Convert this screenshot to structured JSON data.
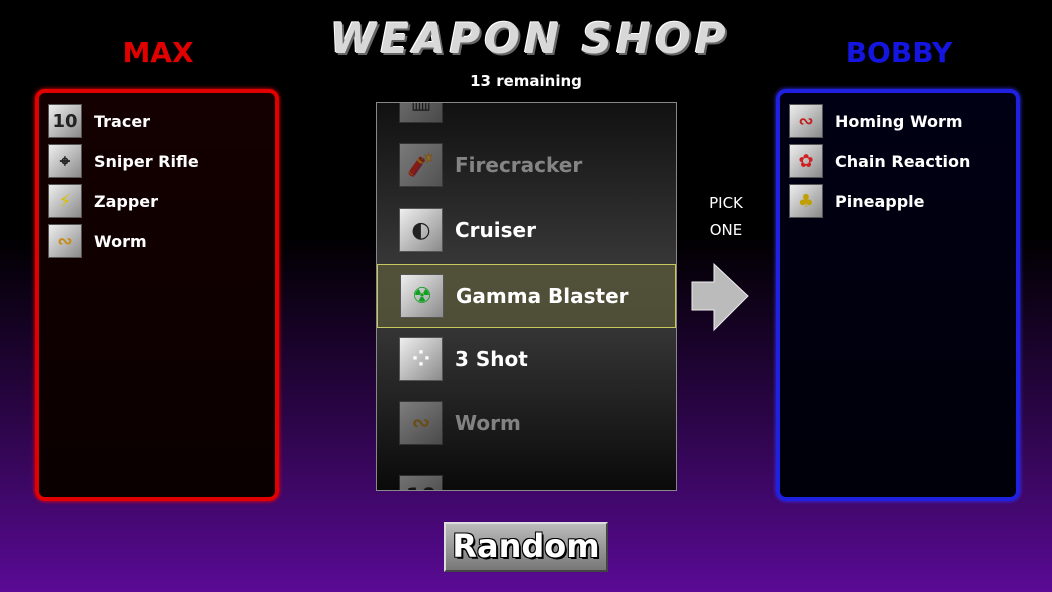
{
  "title": "WEAPON SHOP",
  "remaining": "13 remaining",
  "player1": {
    "name": "MAX",
    "color": "#e00000",
    "weapons": [
      {
        "label": "Tracer",
        "icon": "10"
      },
      {
        "label": "Sniper Rifle",
        "icon": "⌖"
      },
      {
        "label": "Zapper",
        "icon": "⚡"
      },
      {
        "label": "Worm",
        "icon": "∾"
      }
    ]
  },
  "player2": {
    "name": "BOBBY",
    "color": "#1010e0",
    "weapons": [
      {
        "label": "Homing Worm",
        "icon": "∾"
      },
      {
        "label": "Chain Reaction",
        "icon": "✿"
      },
      {
        "label": "Pineapple",
        "icon": "♣"
      }
    ]
  },
  "shop": {
    "items": [
      {
        "label": "",
        "icon": "▥"
      },
      {
        "label": "Firecracker",
        "icon": "🧨"
      },
      {
        "label": "Cruiser",
        "icon": "◐"
      },
      {
        "label": "Gamma Blaster",
        "icon": "☢"
      },
      {
        "label": "3 Shot",
        "icon": "⁘"
      },
      {
        "label": "Worm",
        "icon": "∾"
      },
      {
        "label": "",
        "icon": "10"
      }
    ]
  },
  "pick_label": {
    "line1": "PICK",
    "line2": "ONE"
  },
  "random_button": "Random"
}
